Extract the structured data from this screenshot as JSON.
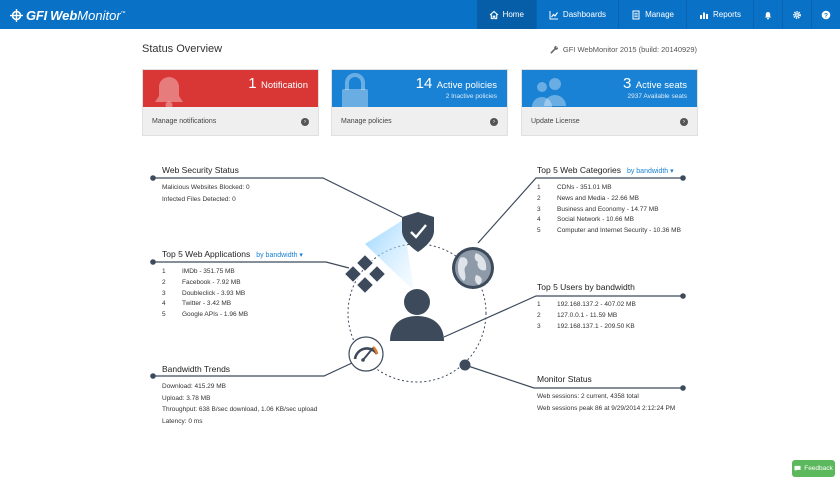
{
  "brand": {
    "gfi": "GFI",
    "web": "Web",
    "monitor": "Monitor",
    "tm": "™"
  },
  "nav": {
    "home": "Home",
    "dashboards": "Dashboards",
    "manage": "Manage",
    "reports": "Reports"
  },
  "icons": {
    "logo": "gfi-logo-icon",
    "home": "home-icon",
    "dashboards": "chart-icon",
    "manage": "document-icon",
    "reports": "bar-chart-icon",
    "notifications": "bell-icon",
    "settings": "gear-icon",
    "help": "help-icon",
    "wrench": "wrench-icon",
    "tile_notification": "bell-icon",
    "tile_policies": "lock-icon",
    "tile_seats": "users-icon",
    "security": "shield-check-icon",
    "categories": "globe-icon",
    "applications": "apps-diamond-icon",
    "users": "user-icon",
    "bandwidth": "speedometer-icon",
    "monitor": "status-dot-icon",
    "feedback": "comment-icon"
  },
  "colors": {
    "topbar": "#0a72c6",
    "nav_active": "#075ea8",
    "tile_red": "#d93636",
    "tile_blue": "#1a82d4",
    "accent_dark": "#3d4a5c",
    "feedback": "#5cb85c"
  },
  "header": {
    "title": "Status Overview",
    "build": "GFI WebMonitor 2015 (build: 20140929)"
  },
  "tiles": [
    {
      "number": "1",
      "word": "Notification",
      "sub": "",
      "action": "Manage notifications"
    },
    {
      "number": "14",
      "word": "Active policies",
      "sub": "2 Inactive policies",
      "action": "Manage policies"
    },
    {
      "number": "3",
      "word": "Active seats",
      "sub": "2937 Available seats",
      "action": "Update License"
    }
  ],
  "web_security": {
    "title": "Web Security Status",
    "lines": [
      "Malicious Websites Blocked: 0",
      "Infected Files Detected: 0"
    ]
  },
  "web_applications": {
    "title": "Top 5 Web Applications",
    "link": "by bandwidth",
    "items": [
      {
        "rank": "1",
        "text": "IMDb - 351.75 MB"
      },
      {
        "rank": "2",
        "text": "Facebook - 7.92 MB"
      },
      {
        "rank": "3",
        "text": "Doubleclick - 3.93 MB"
      },
      {
        "rank": "4",
        "text": "Twitter - 3.42 MB"
      },
      {
        "rank": "5",
        "text": "Google APIs - 1.96 MB"
      }
    ]
  },
  "bandwidth": {
    "title": "Bandwidth Trends",
    "lines": [
      "Download: 415.29 MB",
      "Upload: 3.78 MB",
      "Throughput: 638 B/sec download, 1.06 KB/sec upload",
      "Latency: 0 ms"
    ]
  },
  "web_categories": {
    "title": "Top 5 Web Categories",
    "link": "by bandwidth",
    "items": [
      {
        "rank": "1",
        "text": "CDNs - 351.01 MB"
      },
      {
        "rank": "2",
        "text": "News and Media - 22.66 MB"
      },
      {
        "rank": "3",
        "text": "Business and Economy - 14.77 MB"
      },
      {
        "rank": "4",
        "text": "Social Network - 10.66 MB"
      },
      {
        "rank": "5",
        "text": "Computer and Internet Security - 10.36 MB"
      }
    ]
  },
  "top_users": {
    "title": "Top 5 Users by bandwidth",
    "items": [
      {
        "rank": "1",
        "text": "192.168.137.2 - 407.02 MB"
      },
      {
        "rank": "2",
        "text": "127.0.0.1 - 11.59 MB"
      },
      {
        "rank": "3",
        "text": "192.168.137.1 - 209.50 KB"
      }
    ]
  },
  "monitor_status": {
    "title": "Monitor Status",
    "lines": [
      "Web sessions: 2 current, 4358 total",
      "Web sessions peak 86 at 9/29/2014 2:12:24 PM"
    ]
  },
  "feedback": "Feedback"
}
